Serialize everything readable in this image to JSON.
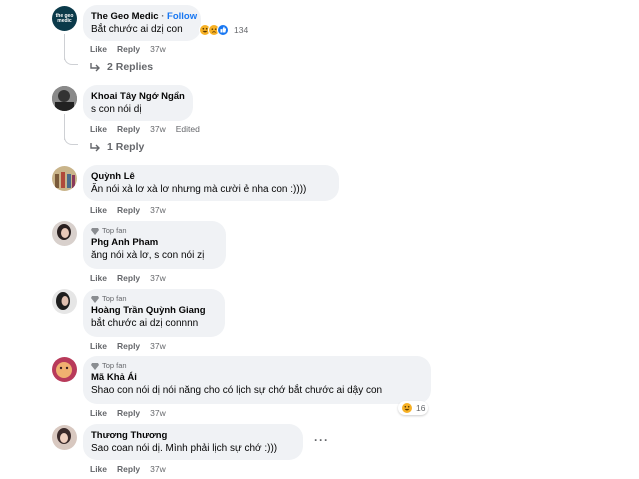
{
  "comments": [
    {
      "author": "The Geo Medic",
      "follow": "Follow",
      "avatar_text": "the geo medic",
      "text": "Bắt chước ai dzị con",
      "like": "Like",
      "reply": "Reply",
      "time": "37w",
      "reaction_count": "134",
      "replies": "2 Replies"
    },
    {
      "author": "Khoai Tây Ngớ Ngẩn",
      "text": "s con nói dị",
      "like": "Like",
      "reply": "Reply",
      "time": "37w",
      "edited": "Edited",
      "replies": "1 Reply"
    },
    {
      "author": "Quỳnh Lê",
      "text": "Ăn nói xà lơ xà lơ nhưng mà cười ẻ nha con :))))",
      "like": "Like",
      "reply": "Reply",
      "time": "37w"
    },
    {
      "badge": "Top fan",
      "author": "Phg Anh Pham",
      "text": "ăng nói xà lơ, s con nói zị",
      "like": "Like",
      "reply": "Reply",
      "time": "37w"
    },
    {
      "badge": "Top fan",
      "author": "Hoàng Trần Quỳnh Giang",
      "text": "bắt chước ai dzị connnn",
      "like": "Like",
      "reply": "Reply",
      "time": "37w"
    },
    {
      "badge": "Top fan",
      "author": "Mã Khả Ái",
      "text": "Shao con nói dị nói năng cho có lịch sự chớ bắt chước ai dậy con",
      "like": "Like",
      "reply": "Reply",
      "time": "37w",
      "reaction_count": "16"
    },
    {
      "author": "Thương Thương",
      "text": "Sao coan nói dị. Mình phải lịch sự chớ :)))",
      "like": "Like",
      "reply": "Reply",
      "time": "37w",
      "more": "···"
    }
  ],
  "colors": {
    "bubble": "#f0f2f5",
    "secondary_text": "#65676b",
    "follow_blue": "#1877f2",
    "haha_yellow": "#f7b125",
    "like_blue": "#1877f2"
  }
}
